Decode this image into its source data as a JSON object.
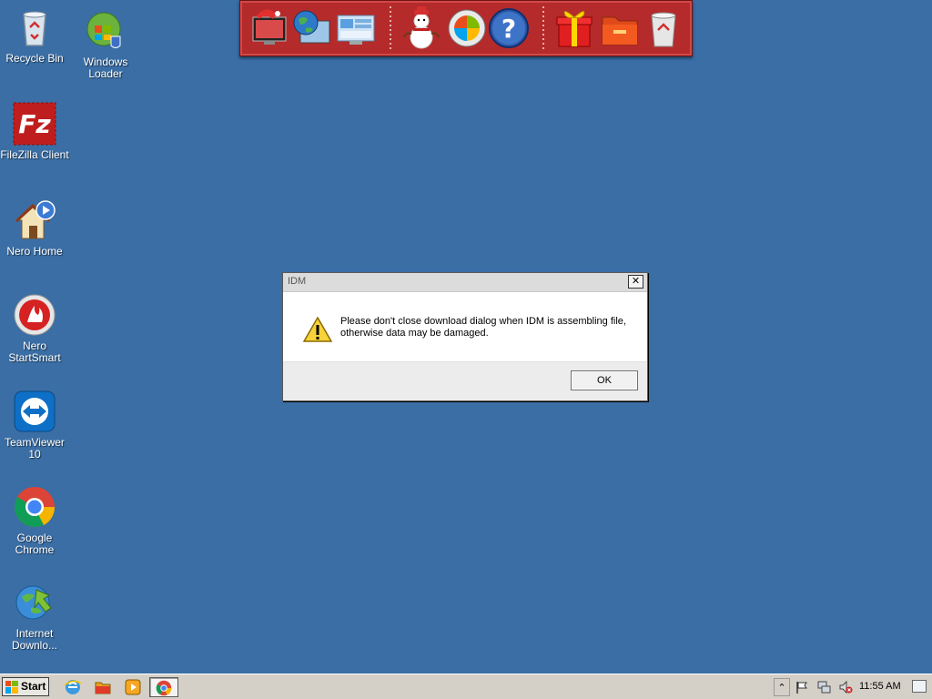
{
  "desktop": {
    "icons": [
      {
        "label": "Recycle Bin",
        "icon": "recycle-bin-icon"
      },
      {
        "label": "Windows\nLoader",
        "label_line1": "Windows",
        "label_line2": "Loader",
        "icon": "windows-loader-icon"
      },
      {
        "label": "FileZilla Client",
        "icon": "filezilla-icon"
      },
      {
        "label": "Nero Home",
        "icon": "nero-home-icon"
      },
      {
        "label_line1": "Nero",
        "label_line2": "StartSmart",
        "icon": "nero-startsmart-icon"
      },
      {
        "label": "TeamViewer 10",
        "icon": "teamviewer-icon"
      },
      {
        "label": "Google Chrome",
        "icon": "chrome-icon"
      },
      {
        "label_line1": "Internet",
        "label_line2": "Downlo...",
        "icon": "idm-icon"
      }
    ]
  },
  "launchbar": {
    "items": [
      "christmas-monitor-icon",
      "globe-monitor-icon",
      "control-panel-icon",
      "snowman-icon",
      "windows-logo-icon",
      "help-icon",
      "gift-icon",
      "folder-icon",
      "trash-icon"
    ]
  },
  "dialog": {
    "title": "IDM",
    "close_glyph": "✕",
    "message_line1": "Please don't close download dialog when IDM is assembling file,",
    "message_line2": "otherwise data may be damaged.",
    "ok_label": "OK",
    "icon": "warning-icon"
  },
  "taskbar": {
    "start_label": "Start",
    "quick_launch": [
      "ie-icon",
      "explorer-icon",
      "media-player-icon"
    ],
    "active_task": "chrome-icon",
    "tray": {
      "expand_glyph": "⌃",
      "icons": [
        "action-center-flag-icon",
        "network-icon",
        "volume-muted-icon"
      ],
      "clock": "11:55 AM"
    }
  },
  "colors": {
    "desktop_bg": "#3a6ea5",
    "launchbar_bg": "#b52a2a"
  }
}
